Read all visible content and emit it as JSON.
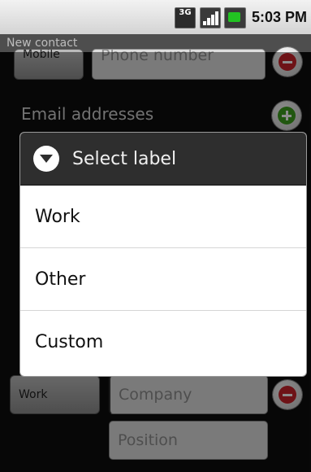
{
  "statusbar": {
    "network_type": "3G",
    "time": "5:03 PM"
  },
  "titlebar": {
    "title": "New contact"
  },
  "form": {
    "phone_label_button": "Mobile",
    "phone_placeholder": "Phone number",
    "email_section_title": "Email addresses",
    "org_label_button": "Work",
    "company_placeholder": "Company",
    "position_placeholder": "Position"
  },
  "dialog": {
    "title": "Select label",
    "options": [
      "Work",
      "Other",
      "Custom"
    ]
  },
  "colors": {
    "remove": "#c9242a",
    "add": "#3d9e1e",
    "dialog_header": "#2e2e2e"
  }
}
